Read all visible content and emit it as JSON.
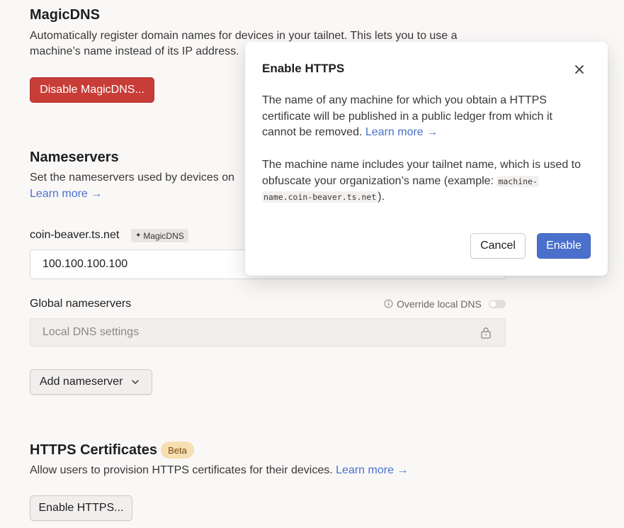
{
  "magicdns": {
    "title": "MagicDNS",
    "desc_line1": "Automatically register domain names for devices in your tailnet. This lets you to use a",
    "desc_line2": "machine’s name instead of its IP address.",
    "button": "Disable MagicDNS..."
  },
  "nameservers": {
    "title": "Nameservers",
    "desc": "Set the nameservers used by devices on",
    "learn_more": "Learn more →",
    "tailnet_label": "coin-beaver.ts.net",
    "magic_badge": "MagicDNS",
    "tailnet_value": "100.100.100.100",
    "global_label": "Global nameservers",
    "override_label": "Override local DNS",
    "override_enabled": false,
    "local_placeholder": "Local DNS settings",
    "add_button": "Add nameserver"
  },
  "https": {
    "title": "HTTPS Certificates",
    "badge": "Beta",
    "desc": "Allow users to provision HTTPS certificates for their devices.",
    "learn_more": "Learn more →",
    "button": "Enable HTTPS..."
  },
  "dialog": {
    "title": "Enable HTTPS",
    "p1_line1": "The name of any machine for which you obtain a HTTPS",
    "p1_line2": "certificate will be published in a public ledger from which it",
    "p1_line3": "cannot be removed.",
    "p1_link": "Learn more →",
    "p2_line1": "The machine name includes your tailnet name, which is used to",
    "p2_line2": "obfuscate your organization’s name (example:",
    "p2_code1": "machine-",
    "p2_code2": "name.coin-beaver.ts.net",
    "p2_end": ").",
    "cancel": "Cancel",
    "enable": "Enable"
  }
}
